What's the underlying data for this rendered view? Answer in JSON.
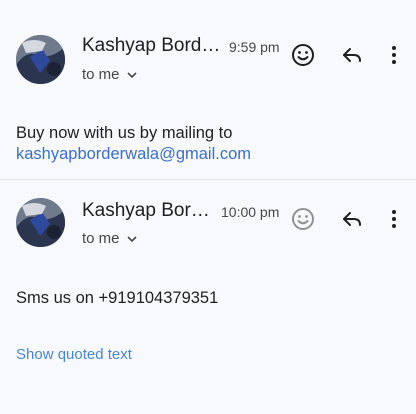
{
  "messages": [
    {
      "sender": "Kashyap Border...",
      "time": "9:59 pm",
      "recipient_label": "to me",
      "body_line1": "Buy now with us by mailing to",
      "body_email": "kashyapborderwala@gmail.com"
    },
    {
      "sender": "Kashyap Bord...",
      "time": "10:00 pm",
      "recipient_label": "to me",
      "body_line1": "Sms us on +919104379351",
      "show_quoted": "Show quoted text"
    }
  ],
  "icons": {
    "react": "smiley-icon",
    "reply": "reply-icon",
    "more": "more-vert-icon",
    "expand": "chevron-down-icon"
  },
  "colors": {
    "background": "#f7f9fd",
    "link": "#3b6fc4",
    "quoted_link": "#4a86c8",
    "secondary_text": "#444746"
  }
}
